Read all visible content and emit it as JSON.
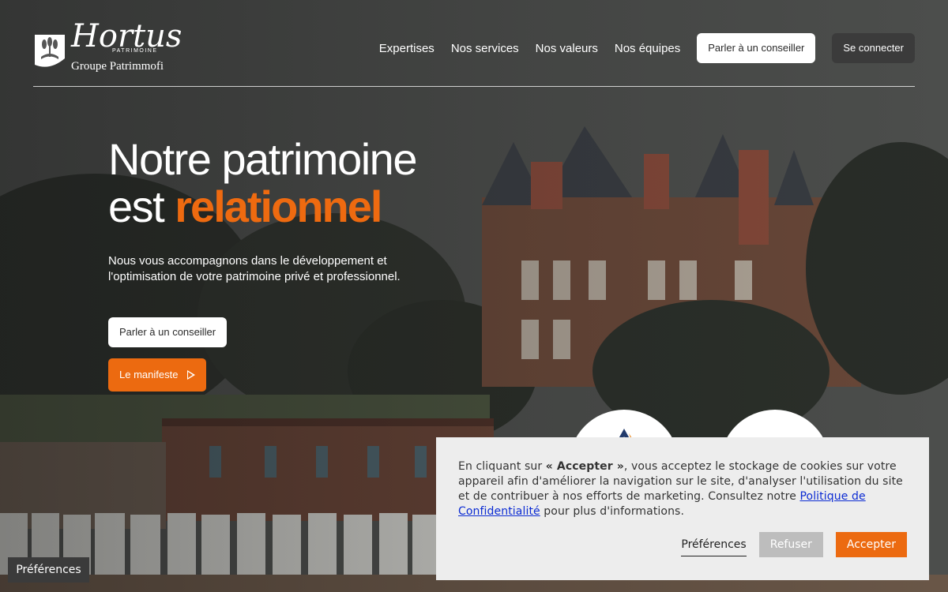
{
  "brand": {
    "name": "Hortus",
    "tagline": "PATRIMOINE",
    "group": "Groupe Patrimmofi"
  },
  "nav": {
    "items": [
      "Expertises",
      "Nos services",
      "Nos valeurs",
      "Nos équipes"
    ],
    "advisor_label": "Parler à un conseiller",
    "login_label": "Se connecter"
  },
  "hero": {
    "title_line1": "Notre patrimoine",
    "title_line2_prefix": "est ",
    "title_accent": "relationnel",
    "subtitle": "Nous vous accompagnons dans le développement et l'optimisation de votre patrimoine privé et professionnel.",
    "advisor_label": "Parler à un conseiller",
    "manifest_label": "Le manifeste"
  },
  "cookie": {
    "text_before": "En cliquant sur ",
    "text_bold": "« Accepter »",
    "text_middle": ", vous acceptez le stockage de cookies sur votre appareil afin d'améliorer la navigation sur le site, d'analyser l'utilisation du site et de contribuer à nos efforts de marketing. Consultez notre ",
    "link_label": "Politique de Confidentialité",
    "text_after": " pour plus d'informations.",
    "prefs_label": "Préférences",
    "refuse_label": "Refuser",
    "accept_label": "Accepter"
  },
  "floating_prefs_label": "Préférences",
  "colors": {
    "accent": "#ec6a10",
    "link": "#0b2bd3",
    "dark_button": "#3b3b3b",
    "cookie_bg": "#ededed"
  }
}
